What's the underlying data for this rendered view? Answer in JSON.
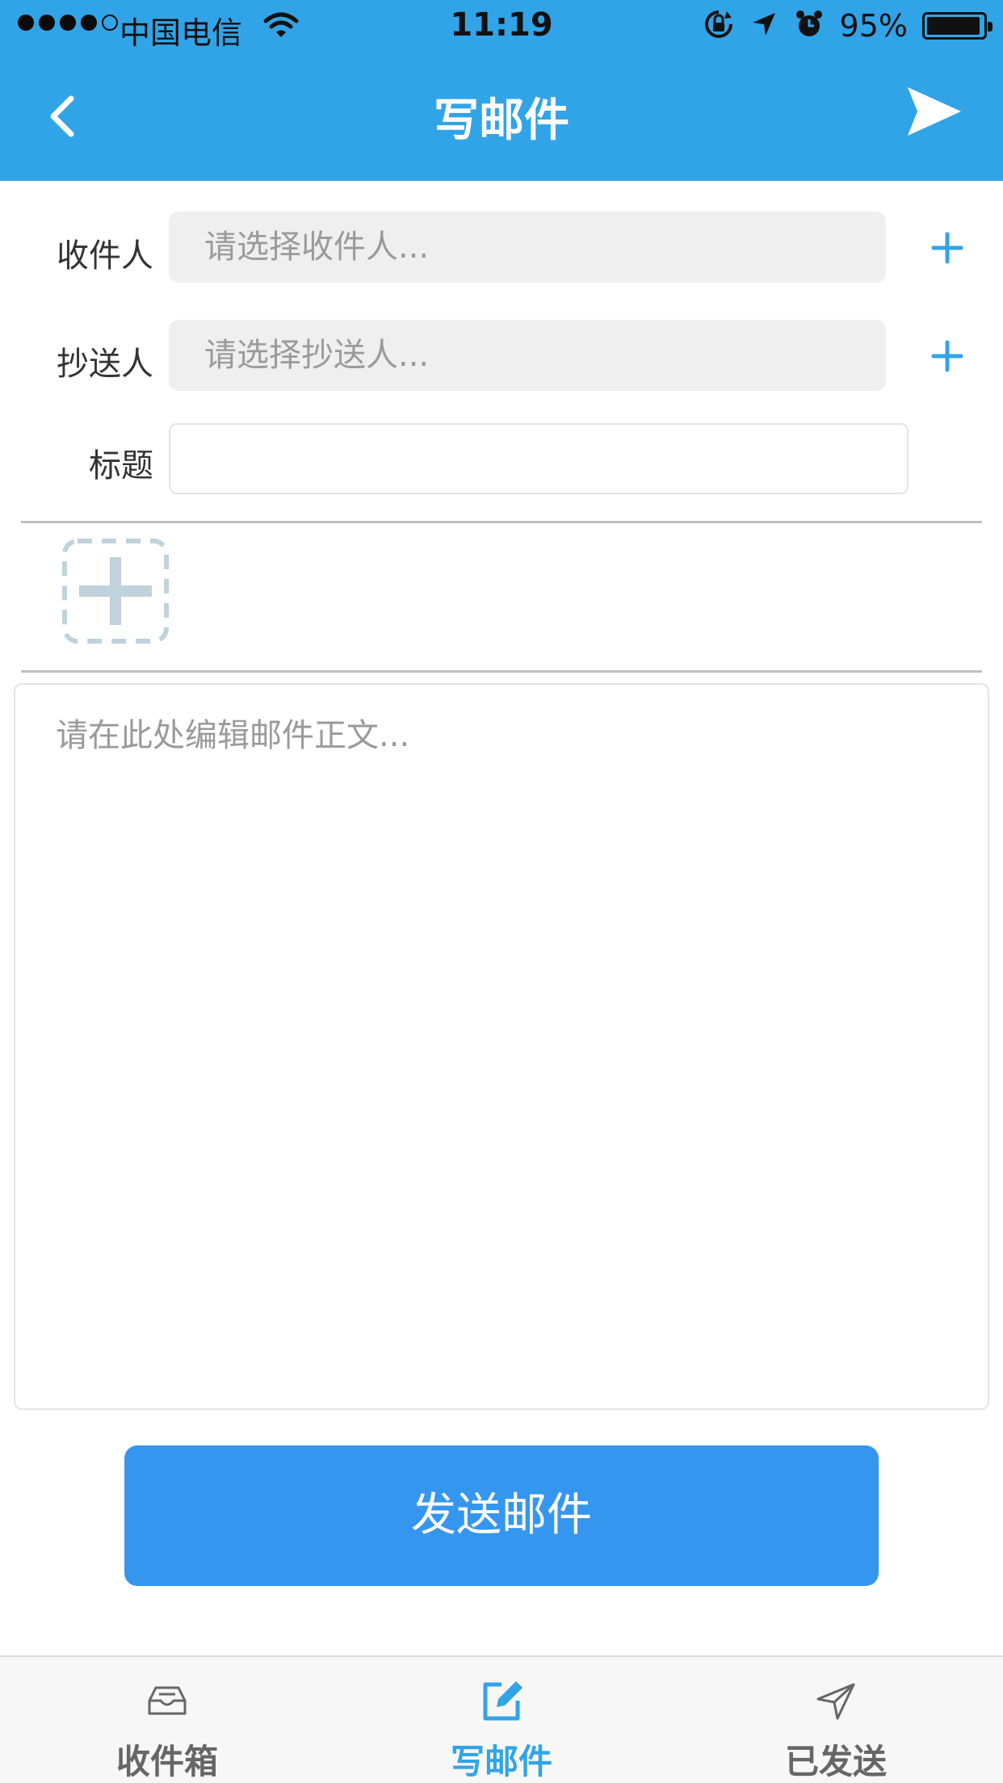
{
  "status_bar": {
    "carrier": "中国电信",
    "time": "11:19",
    "battery": "95%",
    "battery_level": 0.95,
    "signal_bars": 4,
    "signal_max": 5
  },
  "nav": {
    "title": "写邮件",
    "back_icon": "chevron-left-icon",
    "send_icon": "paper-plane-icon"
  },
  "form": {
    "to_label": "收件人",
    "to_placeholder": "请选择收件人...",
    "cc_label": "抄送人",
    "cc_placeholder": "请选择抄送人...",
    "subject_label": "标题",
    "subject_value": "",
    "body_placeholder": "请在此处编辑邮件正文...",
    "add_icon": "plus-icon",
    "attach_icon": "add-attachment-icon"
  },
  "send_button": {
    "label": "发送邮件"
  },
  "tabbar": {
    "tabs": [
      {
        "label": "收件箱",
        "icon": "inbox-icon",
        "active": false
      },
      {
        "label": "写邮件",
        "icon": "compose-icon",
        "active": true
      },
      {
        "label": "已发送",
        "icon": "sent-icon",
        "active": false
      }
    ]
  },
  "colors": {
    "header": "#31a4e8",
    "accent": "#31a4e8",
    "button": "#3596f0",
    "tab_inactive": "#666666"
  }
}
